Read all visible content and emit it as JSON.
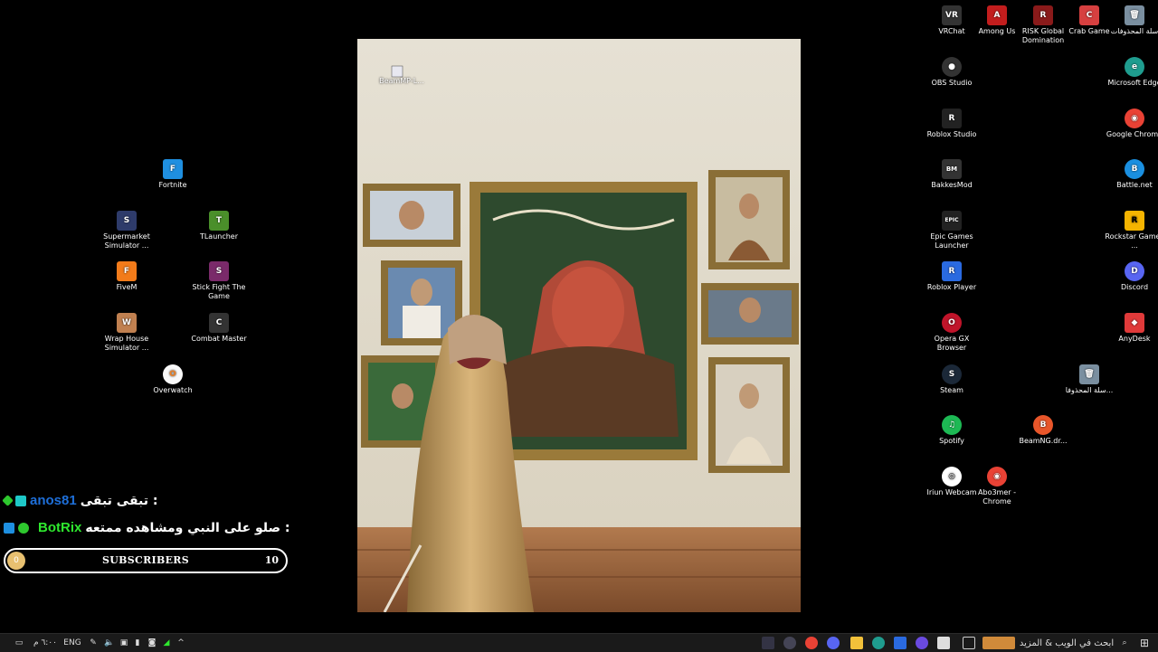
{
  "desktop_left": [
    {
      "name": "fortnite",
      "label": "Fortnite",
      "color": "#1f8fe0",
      "glyph": "F"
    },
    {
      "name": "supermarket",
      "label": "Supermarket Simulator ...",
      "color": "#2e3b6a",
      "glyph": "S"
    },
    {
      "name": "tlauncher",
      "label": "TLauncher",
      "color": "#4a8f2a",
      "glyph": "T"
    },
    {
      "name": "fivem",
      "label": "FiveM",
      "color": "#f27b1a",
      "glyph": "F"
    },
    {
      "name": "stickfight",
      "label": "Stick Fight The Game",
      "color": "#7a2a6a",
      "glyph": "S"
    },
    {
      "name": "wraphouse",
      "label": "Wrap House Simulator ...",
      "color": "#c08050",
      "glyph": "W"
    },
    {
      "name": "combatmaster",
      "label": "Combat Master",
      "color": "#333",
      "glyph": "C"
    },
    {
      "name": "overwatch",
      "label": "Overwatch",
      "color": "#f9f9f9",
      "glyph": "O"
    }
  ],
  "desktop_right": [
    {
      "name": "vrchat",
      "label": "VRChat",
      "color": "#333",
      "glyph": "VR"
    },
    {
      "name": "amongus",
      "label": "Among Us",
      "color": "#c21d1d",
      "glyph": "A"
    },
    {
      "name": "risk",
      "label": "RISK Global Domination",
      "color": "#8a1a1a",
      "glyph": "R"
    },
    {
      "name": "crabgame",
      "label": "Crab Game",
      "color": "#d64040",
      "glyph": "C"
    },
    {
      "name": "recycle",
      "label": "سلة المحذوفات",
      "color": "#7a8fa0",
      "glyph": "🗑"
    },
    {
      "name": "obs",
      "label": "OBS Studio",
      "color": "#333",
      "glyph": "●"
    },
    {
      "name": "edge",
      "label": "Microsoft Edge",
      "color": "#1f9d8f",
      "glyph": "e"
    },
    {
      "name": "robloxstudio",
      "label": "Roblox Studio",
      "color": "#222",
      "glyph": "R"
    },
    {
      "name": "chrome",
      "label": "Google Chrome",
      "color": "#e94235",
      "glyph": "◉"
    },
    {
      "name": "bakkesmod",
      "label": "BakkesMod",
      "color": "#333",
      "glyph": "BM"
    },
    {
      "name": "battlenet",
      "label": "Battle.net",
      "color": "#1a8fe0",
      "glyph": "B"
    },
    {
      "name": "epic",
      "label": "Epic Games Launcher",
      "color": "#222",
      "glyph": "EPIC"
    },
    {
      "name": "rockstar",
      "label": "Rockstar Games ...",
      "color": "#f5b400",
      "glyph": "R"
    },
    {
      "name": "robloxplayer",
      "label": "Roblox Player",
      "color": "#2a6ae0",
      "glyph": "R"
    },
    {
      "name": "discord",
      "label": "Discord",
      "color": "#5865f2",
      "glyph": "D"
    },
    {
      "name": "operagx",
      "label": "Opera GX Browser",
      "color": "#c0142a",
      "glyph": "O"
    },
    {
      "name": "anydesk",
      "label": "AnyDesk",
      "color": "#e03a3a",
      "glyph": "◆"
    },
    {
      "name": "steam",
      "label": "Steam",
      "color": "#1b2838",
      "glyph": "S"
    },
    {
      "name": "recycle2",
      "label": "سلة المحذوفا...",
      "color": "#7a8fa0",
      "glyph": "🗑"
    },
    {
      "name": "spotify",
      "label": "Spotify",
      "color": "#1db954",
      "glyph": "♫"
    },
    {
      "name": "beamng",
      "label": "BeamNG.dr...",
      "color": "#e8562a",
      "glyph": "B"
    },
    {
      "name": "iriun",
      "label": "Iriun Webcam",
      "color": "#1a1a1a",
      "glyph": "◎"
    },
    {
      "name": "abo3mer",
      "label": "Abo3mer - Chrome",
      "color": "#e94235",
      "glyph": "◉"
    }
  ],
  "wallpaper": {
    "shortcut_label": "BeamMP-L..."
  },
  "chat": [
    {
      "user": "anos81",
      "message": "تبقى تبقى :",
      "user_color": "#1e6fd9"
    },
    {
      "user": "BotRix",
      "message": "صلو على النبي ومشاهده ممتعه :",
      "user_color": "#2ee82e"
    }
  ],
  "subscribers": {
    "label": "SUBSCRIBERS",
    "count": "10",
    "start": "0"
  },
  "taskbar": {
    "clock": "٦:٠٠ م",
    "language": "ENG",
    "search_placeholder": "ابحث في الويب & المزيد"
  }
}
